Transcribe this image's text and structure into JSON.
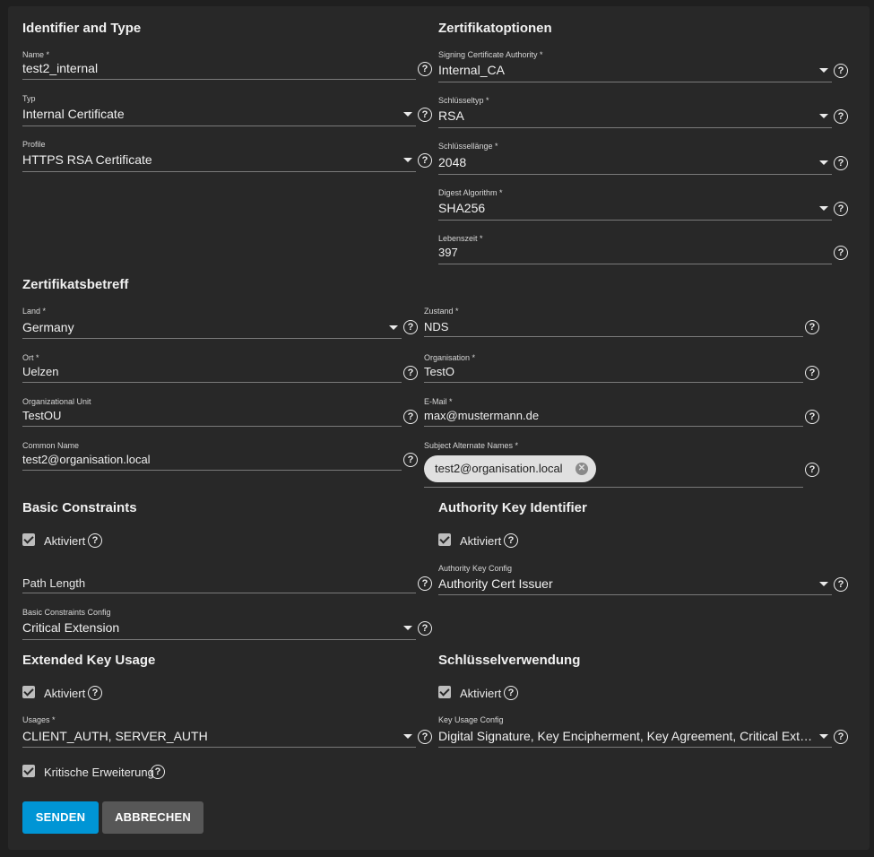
{
  "sections": {
    "identifier": "Identifier and Type",
    "options": "Zertifikatoptionen",
    "subject": "Zertifikatsbetreff",
    "basic": "Basic Constraints",
    "aki": "Authority Key Identifier",
    "eku": "Extended Key Usage",
    "ku": "Schlüsselverwendung"
  },
  "fields": {
    "name": {
      "label": "Name *",
      "value": "test2_internal"
    },
    "typ": {
      "label": "Typ",
      "value": "Internal Certificate"
    },
    "profile": {
      "label": "Profile",
      "value": "HTTPS RSA Certificate"
    },
    "signing_ca": {
      "label": "Signing Certificate Authority *",
      "value": "Internal_CA"
    },
    "key_type": {
      "label": "Schlüsseltyp *",
      "value": "RSA"
    },
    "key_length": {
      "label": "Schlüssellänge *",
      "value": "2048"
    },
    "digest": {
      "label": "Digest Algorithm *",
      "value": "SHA256"
    },
    "lifetime": {
      "label": "Lebenszeit *",
      "value": "397"
    },
    "country": {
      "label": "Land *",
      "value": "Germany"
    },
    "state": {
      "label": "Zustand *",
      "value": "NDS"
    },
    "city": {
      "label": "Ort *",
      "value": "Uelzen"
    },
    "organization": {
      "label": "Organisation *",
      "value": "TestO"
    },
    "org_unit": {
      "label": "Organizational Unit",
      "value": "TestOU"
    },
    "email": {
      "label": "E-Mail *",
      "value": "max@mustermann.de"
    },
    "common_name": {
      "label": "Common Name",
      "value": "test2@organisation.local"
    },
    "san": {
      "label": "Subject Alternate Names *",
      "chip": "test2@organisation.local"
    },
    "path_length": {
      "placeholder": "Path Length"
    },
    "aki_config": {
      "label": "Authority Key Config",
      "value": "Authority Cert Issuer"
    },
    "bc_config": {
      "label": "Basic Constraints Config",
      "value": "Critical Extension"
    },
    "usages": {
      "label": "Usages *",
      "value": "CLIENT_AUTH, SERVER_AUTH"
    },
    "ku_config": {
      "label": "Key Usage Config",
      "value": "Digital Signature, Key Encipherment, Key Agreement, Critical Extension"
    }
  },
  "checkboxes": {
    "bc_enabled": "Aktiviert",
    "aki_enabled": "Aktiviert",
    "eku_enabled": "Aktiviert",
    "ku_enabled": "Aktiviert",
    "critical_ext": "Kritische Erweiterung"
  },
  "buttons": {
    "submit": "SENDEN",
    "cancel": "ABBRECHEN"
  },
  "help_glyph": "?",
  "close_glyph": "✕",
  "colors": {
    "background": "#1f1f1f",
    "card": "#282828",
    "primary_button": "#0095d5",
    "secondary_button": "#575757",
    "chip": "#e0e0e0"
  },
  "icons": [
    "help-icon",
    "dropdown-caret-icon",
    "check-icon",
    "chip-remove-icon"
  ]
}
